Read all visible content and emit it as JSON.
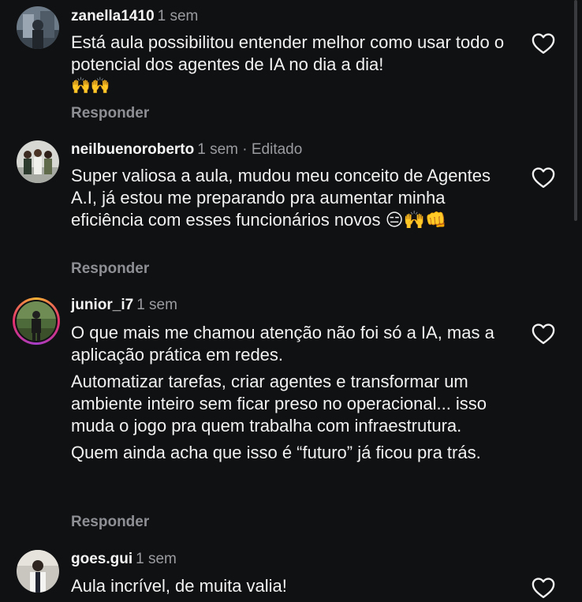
{
  "comments": [
    {
      "username": "zanella1410",
      "time": "1 sem",
      "text": [
        "Está aula possibilitou entender melhor como usar todo o potencial dos agentes de IA no dia a dia!"
      ],
      "emoji": "🙌🙌",
      "reply": "Responder"
    },
    {
      "username": "neilbuenoroberto",
      "time": "1 sem · Editado",
      "text": [
        "Super valiosa a aula, mudou meu conceito de Agentes A.I, já estou me preparando pra aumentar minha eficiência com esses funcionários novos 😑🙌👊"
      ],
      "reply": "Responder"
    },
    {
      "username": "junior_i7",
      "time": "1 sem",
      "text": [
        "O que mais me chamou atenção não foi só a IA, mas a aplicação prática em redes.",
        "Automatizar tarefas, criar agentes e transformar um ambiente inteiro sem ficar preso no operacional... isso muda o jogo pra quem trabalha com infraestrutura.",
        "Quem ainda acha que isso é “futuro” já ficou pra trás."
      ],
      "reply": "Responder"
    },
    {
      "username": "goes.gui",
      "time": "1 sem",
      "text": [
        "Aula incrível, de muita valia!"
      ]
    }
  ],
  "icons": {
    "like": "heart-outline-icon"
  },
  "colors": {
    "background": "#101113",
    "text": "#f5f5f5",
    "muted": "#9a9b9f",
    "story_ring": [
      "#f9b234",
      "#e1306c",
      "#a63ec8"
    ]
  }
}
